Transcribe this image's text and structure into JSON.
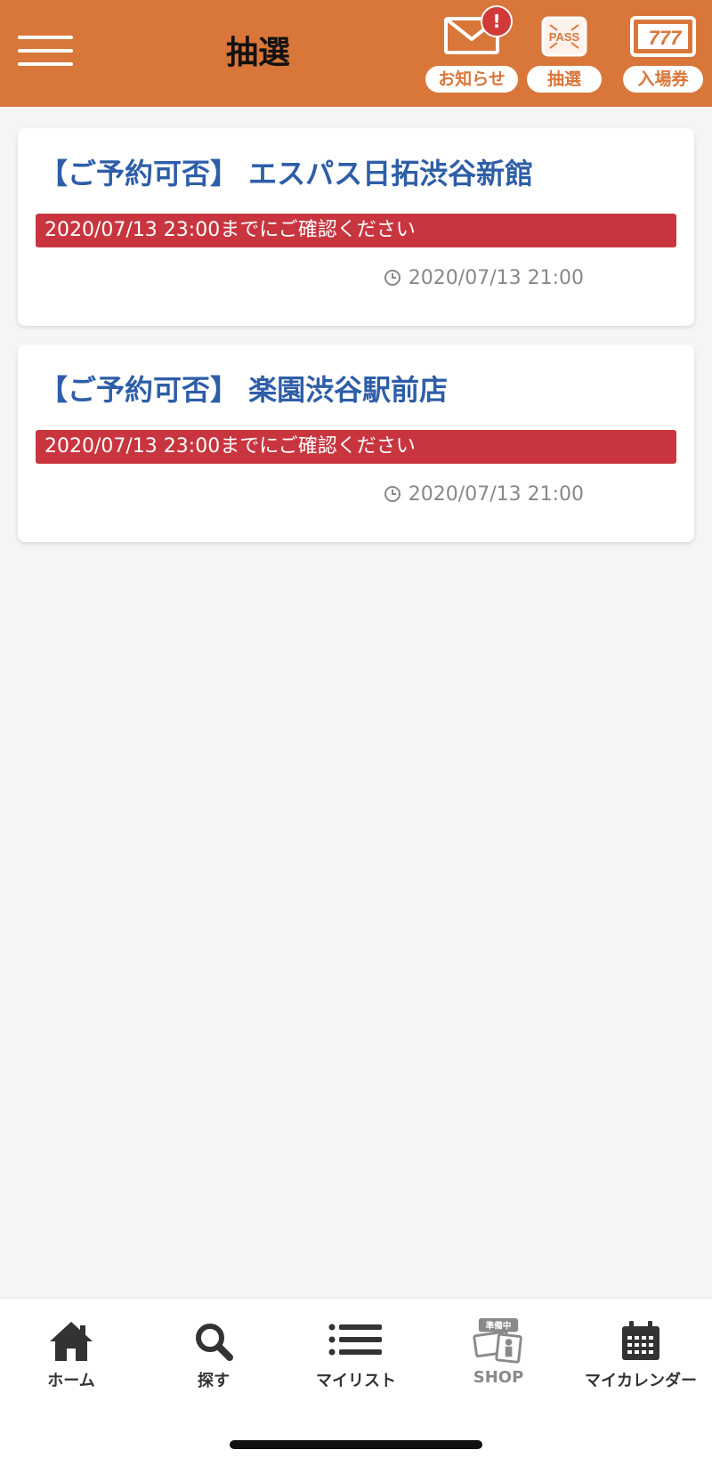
{
  "header": {
    "title": "抽選",
    "menu_icon": "hamburger-menu-icon",
    "bg_color": "#d9763a",
    "items": [
      {
        "label": "お知らせ",
        "icon": "envelope-icon",
        "badge": "!"
      },
      {
        "label": "抽選",
        "icon": "pass-ticket-icon",
        "icon_text": "PASS"
      },
      {
        "label": "入場券",
        "icon": "slot-777-ticket-icon",
        "icon_text": "777"
      }
    ]
  },
  "lottery_list": [
    {
      "title": "【ご予約可否】 エスパス日拓渋谷新館",
      "deadline": "2020/07/13 23:00までにご確認ください",
      "datetime": "2020/07/13 21:00"
    },
    {
      "title": "【ご予約可否】 楽園渋谷駅前店",
      "deadline": "2020/07/13 23:00までにご確認ください",
      "datetime": "2020/07/13 21:00"
    }
  ],
  "bottom_nav": {
    "items": [
      {
        "label": "ホーム",
        "icon": "home-icon"
      },
      {
        "label": "探す",
        "icon": "search-icon"
      },
      {
        "label": "マイリスト",
        "icon": "list-icon"
      },
      {
        "label": "SHOP",
        "icon": "shop-icon",
        "badge": "準備中"
      },
      {
        "label": "マイカレンダー",
        "icon": "calendar-icon"
      }
    ]
  },
  "colors": {
    "accent": "#d9763a",
    "title_blue": "#2e5ea8",
    "deadline_red": "#c9353f",
    "background": "#f5f5f5"
  }
}
